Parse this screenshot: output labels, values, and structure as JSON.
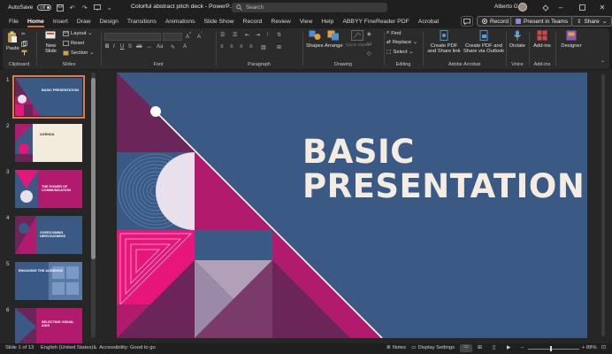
{
  "titlebar": {
    "autosave_label": "AutoSave",
    "autosave_state": "Off",
    "document_title": "Colorful abstract pitch deck  -  PowerP...",
    "search_placeholder": "Search",
    "user_name": "Alberto G"
  },
  "tabs": [
    "File",
    "Home",
    "Insert",
    "Draw",
    "Design",
    "Transitions",
    "Animations",
    "Slide Show",
    "Record",
    "Review",
    "View",
    "Help",
    "ABBYY FineReader PDF",
    "Acrobat"
  ],
  "active_tab": "Home",
  "top_right": {
    "record_label": "Record",
    "present_label": "Present in Teams",
    "share_label": "Share"
  },
  "ribbon": {
    "clipboard": {
      "paste": "Paste",
      "group": "Clipboard"
    },
    "slides": {
      "new_slide_1": "New",
      "new_slide_2": "Slide",
      "layout": "Layout",
      "reset": "Reset",
      "section": "Section",
      "group": "Slides"
    },
    "font": {
      "group": "Font"
    },
    "paragraph": {
      "group": "Paragraph"
    },
    "drawing": {
      "shapes": "Shapes",
      "arrange": "Arrange",
      "quick_styles": "Quick Styles",
      "group": "Drawing"
    },
    "editing": {
      "find": "Find",
      "replace": "Replace",
      "select": "Select",
      "group": "Editing"
    },
    "adobe": {
      "create_share_1": "Create PDF",
      "create_share_2": "and Share link",
      "create_outlook_1": "Create PDF and",
      "create_outlook_2": "Share via Outlook",
      "group": "Adobe Acrobat"
    },
    "voice": {
      "dictate": "Dictate",
      "group": "Voice"
    },
    "addins": {
      "addins": "Add-ins",
      "group": "Add-ins"
    },
    "designer": {
      "label": "Designer"
    }
  },
  "thumbnails": [
    {
      "num": "1",
      "text": "BASIC PRESENTATION",
      "bg": "#3a5a85"
    },
    {
      "num": "2",
      "text": "AGENDA",
      "bg": "#f3ebdc"
    },
    {
      "num": "3",
      "text": "THE POWER OF COMMUNICATION",
      "bg": "#b21a6e"
    },
    {
      "num": "4",
      "text": "OVERCOMING NERVOUSNESS",
      "bg": "#3a5a85"
    },
    {
      "num": "5",
      "text": "ENGAGING THE AUDIENCE",
      "bg": "#3a5a85"
    },
    {
      "num": "6",
      "text": "SELECTING VISUAL AIDS",
      "bg": "#b21a6e"
    }
  ],
  "slide": {
    "title_line1": "BASIC",
    "title_line2": "PRESENTATION"
  },
  "colors": {
    "slide_blue": "#3a5a85",
    "magenta": "#b21a6e",
    "pink": "#e8157a",
    "plum": "#6b2559",
    "cream": "#f3ebdc",
    "accent": "#e06a3c"
  },
  "status": {
    "slide_info": "Slide 1 of 13",
    "language": "English (United States)",
    "accessibility": "Accessibility: Good to go",
    "notes": "Notes",
    "display_settings": "Display Settings",
    "zoom": "88%"
  }
}
